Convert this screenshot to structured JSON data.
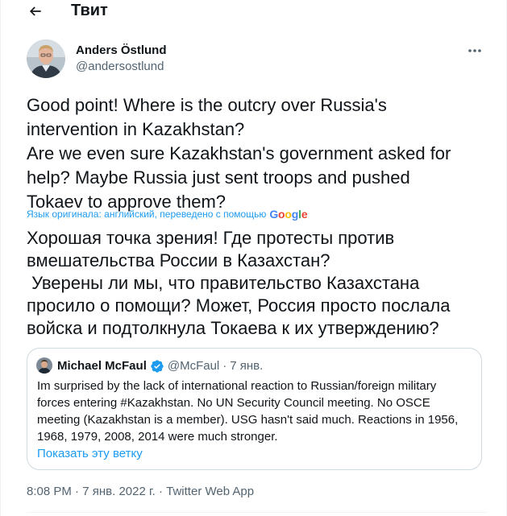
{
  "header": {
    "title": "Твит"
  },
  "tweet": {
    "author_name": "Anders Östlund",
    "author_handle": "@andersostlund",
    "text": "Good point! Where is the outcry over Russia's\nintervention in Kazakhstan?\nAre we even sure Kazakhstan's government asked for\nhelp? Maybe Russia just sent troops and pushed\nTokaev to approve them?",
    "translation_note": "Язык оригинала: английский, переведено с помощью",
    "translation_provider": "Google",
    "translated_text": "Хорошая точка зрения! Где протесты против\nвмешательства России в Казахстан?\n Уверены ли мы, что правительство Казахстана\nпросило о помощи? Может, Россия просто послала\nвойска и подтолкнула Токаева к их утверждению?",
    "time": "8:08 PM",
    "date": "7 янв. 2022 г.",
    "separator": "·",
    "source": "Twitter Web App"
  },
  "quote": {
    "author_name": "Michael McFaul",
    "author_handle": "@McFaul",
    "separator": "·",
    "date": "7 янв.",
    "text": "Im surprised by the lack of international reaction to Russian/foreign military\nforces entering #Kazakhstan. No UN Security Council meeting. No OSCE\nmeeting (Kazakhstan is a member). USG hasn't said much. Reactions in 1956,\n1968, 1979, 2008, 2014 were much stronger.",
    "show_thread": "Показать эту ветку"
  },
  "icons": {
    "back": "arrow-left-icon",
    "more": "more-horizontal-icon",
    "verified": "verified-badge-icon"
  },
  "colors": {
    "accent": "#1d9bf0",
    "text_primary": "#0f1419",
    "text_secondary": "#536471",
    "border": "#cfd9de",
    "google_blue": "#4285F4",
    "google_red": "#EA4335",
    "google_yellow": "#FBBC05",
    "google_green": "#34A853"
  }
}
